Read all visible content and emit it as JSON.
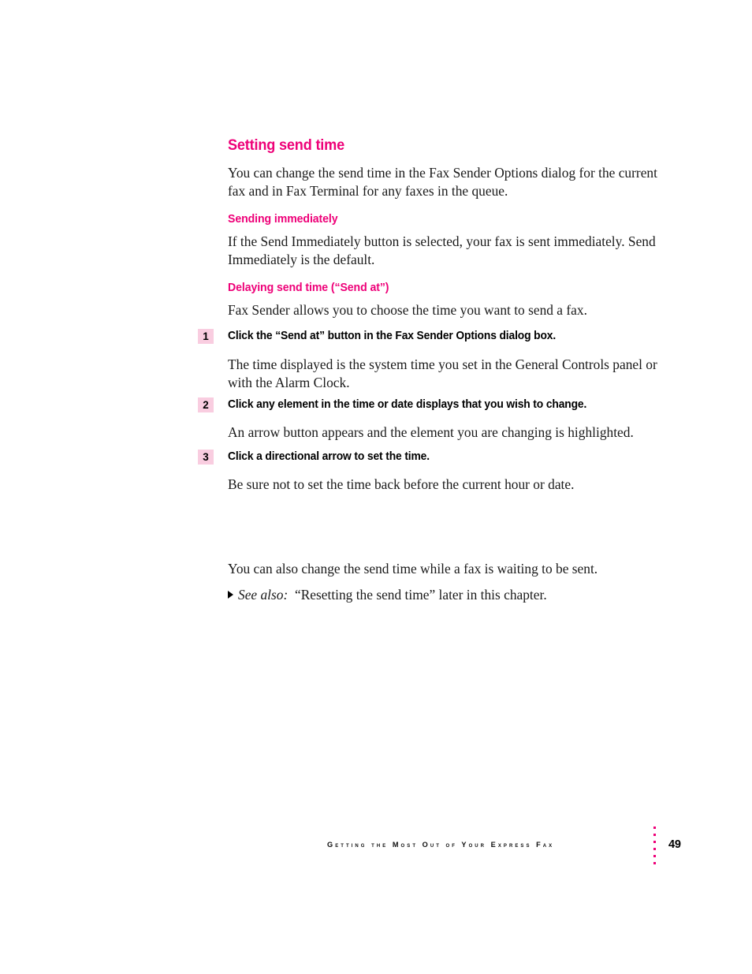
{
  "document": {
    "page_number": "49",
    "accent_color": "#ee0078",
    "badge_color": "#f9cde0"
  },
  "section": {
    "heading": "Setting send time",
    "intro": "You can change the send time in the Fax Sender Options dialog for the current fax and in Fax Terminal for any faxes in the queue."
  },
  "subsections": [
    {
      "heading": "Sending immediately",
      "body": "If the Send Immediately button is selected, your fax is sent immediately. Send Immediately is the default."
    },
    {
      "heading": "Delaying send time (“Send at”)",
      "body": "Fax Sender allows you to choose the time you want to send a fax."
    }
  ],
  "steps": [
    {
      "number": "1",
      "title": "Click the “Send at” button in the Fax Sender Options dialog box.",
      "body": "The time displayed is the system time you set in the General Controls panel or with the Alarm Clock."
    },
    {
      "number": "2",
      "title": "Click any element in the time or date displays that you wish to change.",
      "body": "An arrow button appears and the element you are changing is highlighted."
    },
    {
      "number": "3",
      "title": "Click a directional arrow to set the time.",
      "body": "Be sure not to set the time back before the current hour or date."
    }
  ],
  "closing": {
    "paragraph": "You can also change the send time while a fax is waiting to be sent.",
    "see_also_label": "See also:",
    "see_also_text": "“Resetting the send time” later in this chapter."
  },
  "footer": {
    "title": "Getting the Most Out of Your Express Fax",
    "page": "49"
  }
}
